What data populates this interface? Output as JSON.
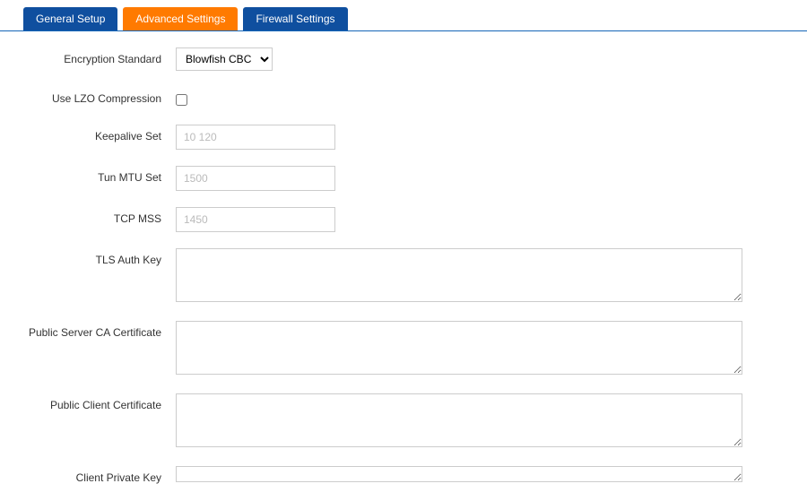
{
  "tabs": {
    "general": "General Setup",
    "advanced": "Advanced Settings",
    "firewall": "Firewall Settings"
  },
  "form": {
    "encryption": {
      "label": "Encryption Standard",
      "selected": "Blowfish CBC",
      "options": [
        "Blowfish CBC"
      ]
    },
    "lzo": {
      "label": "Use LZO Compression",
      "checked": false
    },
    "keepalive": {
      "label": "Keepalive Set",
      "placeholder": "10 120",
      "value": ""
    },
    "tunmtu": {
      "label": "Tun MTU Set",
      "placeholder": "1500",
      "value": ""
    },
    "tcpmss": {
      "label": "TCP MSS",
      "placeholder": "1450",
      "value": ""
    },
    "tlsauth": {
      "label": "TLS Auth Key",
      "value": ""
    },
    "servca": {
      "label": "Public Server CA Certificate",
      "value": ""
    },
    "clientcert": {
      "label": "Public Client Certificate",
      "value": ""
    },
    "clientkey": {
      "label": "Client Private Key",
      "value": ""
    }
  }
}
